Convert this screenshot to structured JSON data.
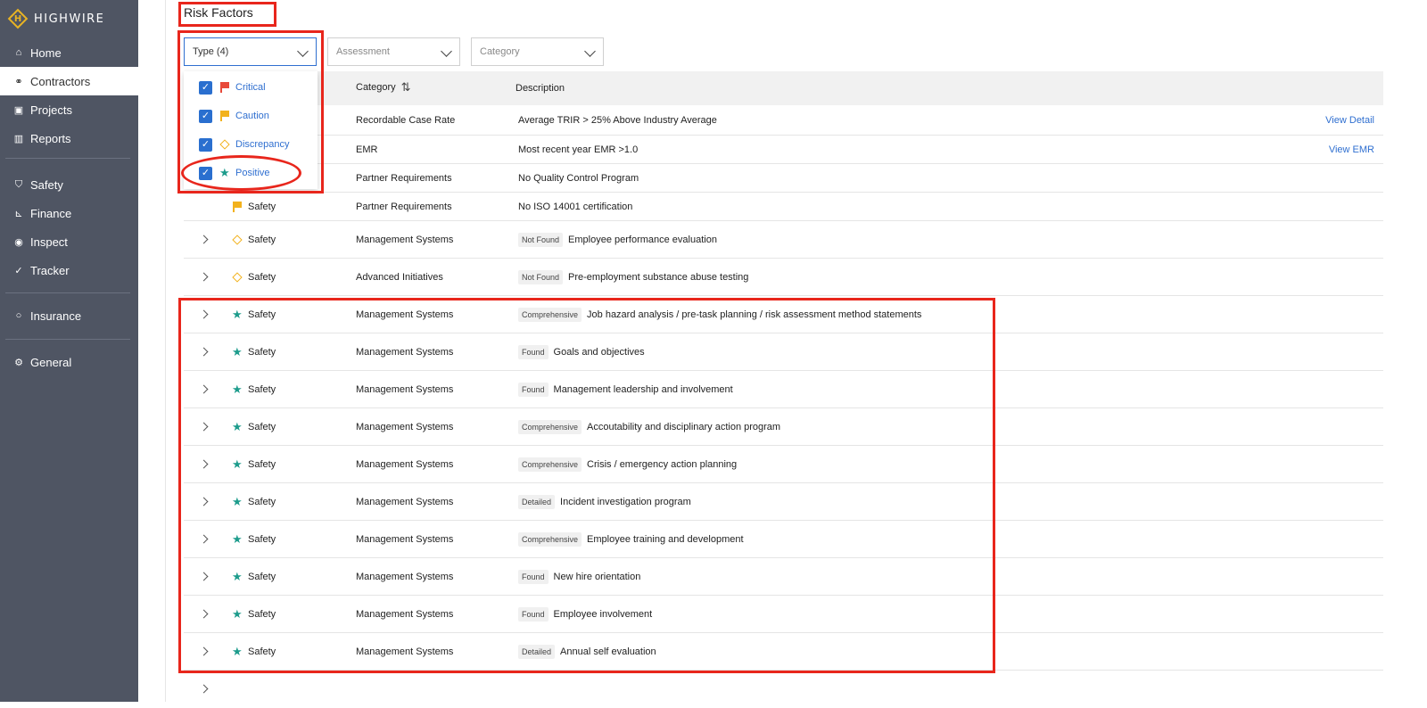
{
  "app": {
    "logo_letter": "H",
    "logo_text": "HIGHWIRE"
  },
  "sidebar": {
    "items": [
      {
        "label": "Home",
        "icon": "home-icon"
      },
      {
        "label": "Contractors",
        "icon": "handshake-icon",
        "active": true
      },
      {
        "label": "Projects",
        "icon": "briefcase-icon"
      },
      {
        "label": "Reports",
        "icon": "bar-chart-icon"
      },
      {
        "label": "Safety",
        "icon": "shield-icon"
      },
      {
        "label": "Finance",
        "icon": "line-chart-icon"
      },
      {
        "label": "Inspect",
        "icon": "eye-icon"
      },
      {
        "label": "Tracker",
        "icon": "checklist-icon"
      },
      {
        "label": "Insurance",
        "icon": "umbrella-icon"
      },
      {
        "label": "General",
        "icon": "gear-icon"
      }
    ]
  },
  "page": {
    "title": "Risk Factors"
  },
  "filters": {
    "type": "Type (4)",
    "assessment": "Assessment",
    "category": "Category"
  },
  "type_options": [
    {
      "label": "Critical",
      "icon": "red-flag-icon",
      "checked": true
    },
    {
      "label": "Caution",
      "icon": "yellow-flag-icon",
      "checked": true
    },
    {
      "label": "Discrepancy",
      "icon": "diamond-icon",
      "checked": true
    },
    {
      "label": "Positive",
      "icon": "star-icon",
      "checked": true
    }
  ],
  "table": {
    "headers": {
      "category": "Category",
      "description": "Description"
    },
    "rows": [
      {
        "type": "",
        "category": "Recordable Case Rate",
        "badge": "",
        "description": "Average TRIR > 25% Above Industry Average",
        "link": "View Detail"
      },
      {
        "type": "",
        "category": "EMR",
        "badge": "",
        "description": "Most recent year EMR >1.0",
        "link": "View EMR"
      },
      {
        "type": "",
        "category": "Partner Requirements",
        "badge": "",
        "description": "No Quality Control Program",
        "link": ""
      },
      {
        "type": "Safety",
        "icon": "yellow-flag-icon",
        "category": "Partner Requirements",
        "badge": "",
        "description": "No ISO 14001 certification",
        "link": ""
      },
      {
        "type": "Safety",
        "icon": "diamond-icon",
        "category": "Management Systems",
        "badge": "Not Found",
        "description": "Employee performance evaluation",
        "link": ""
      },
      {
        "type": "Safety",
        "icon": "diamond-icon",
        "category": "Advanced Initiatives",
        "badge": "Not Found",
        "description": "Pre-employment substance abuse testing",
        "link": ""
      },
      {
        "type": "Safety",
        "icon": "star-icon",
        "category": "Management Systems",
        "badge": "Comprehensive",
        "description": "Job hazard analysis / pre-task planning / risk assessment method statements",
        "link": ""
      },
      {
        "type": "Safety",
        "icon": "star-icon",
        "category": "Management Systems",
        "badge": "Found",
        "description": "Goals and objectives",
        "link": ""
      },
      {
        "type": "Safety",
        "icon": "star-icon",
        "category": "Management Systems",
        "badge": "Found",
        "description": "Management leadership and involvement",
        "link": ""
      },
      {
        "type": "Safety",
        "icon": "star-icon",
        "category": "Management Systems",
        "badge": "Comprehensive",
        "description": "Accoutability and disciplinary action program",
        "link": ""
      },
      {
        "type": "Safety",
        "icon": "star-icon",
        "category": "Management Systems",
        "badge": "Comprehensive",
        "description": "Crisis / emergency action planning",
        "link": ""
      },
      {
        "type": "Safety",
        "icon": "star-icon",
        "category": "Management Systems",
        "badge": "Detailed",
        "description": "Incident investigation program",
        "link": ""
      },
      {
        "type": "Safety",
        "icon": "star-icon",
        "category": "Management Systems",
        "badge": "Comprehensive",
        "description": "Employee training and development",
        "link": ""
      },
      {
        "type": "Safety",
        "icon": "star-icon",
        "category": "Management Systems",
        "badge": "Found",
        "description": "New hire orientation",
        "link": ""
      },
      {
        "type": "Safety",
        "icon": "star-icon",
        "category": "Management Systems",
        "badge": "Found",
        "description": "Employee involvement",
        "link": ""
      },
      {
        "type": "Safety",
        "icon": "star-icon",
        "category": "Management Systems",
        "badge": "Detailed",
        "description": "Annual self evaluation",
        "link": ""
      }
    ]
  },
  "colors": {
    "sidebar": "#4f5563",
    "accent": "#2f6fd0",
    "annotation": "#e8261c",
    "positive": "#1d9c8c",
    "caution": "#f2b21d",
    "critical": "#e84a3a"
  }
}
